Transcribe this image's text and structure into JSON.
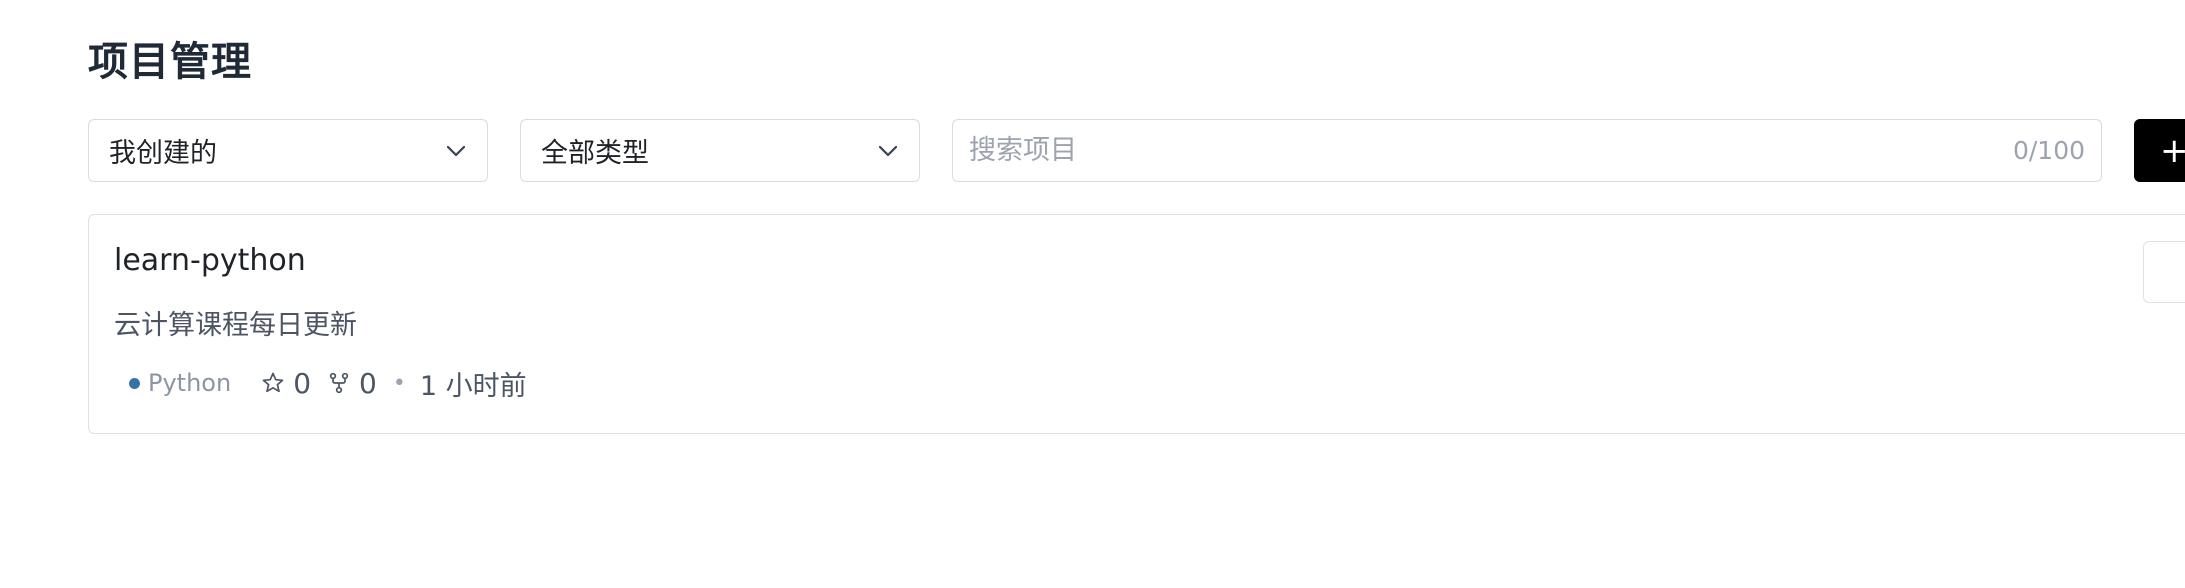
{
  "page": {
    "title": "项目管理"
  },
  "filters": {
    "owner": {
      "value": "我创建的",
      "icon": "chevron-down-icon"
    },
    "type": {
      "value": "全部类型",
      "icon": "chevron-down-icon"
    }
  },
  "search": {
    "placeholder": "搜索项目",
    "value": "",
    "counter": "0/100"
  },
  "new_button": {
    "label": "+"
  },
  "projects": [
    {
      "name": "learn-python",
      "description": "云计算课程每日更新",
      "language": "Python",
      "language_color": "#3572A5",
      "stars": "0",
      "forks": "0",
      "separator": "•",
      "updated": "1 小时前"
    }
  ]
}
